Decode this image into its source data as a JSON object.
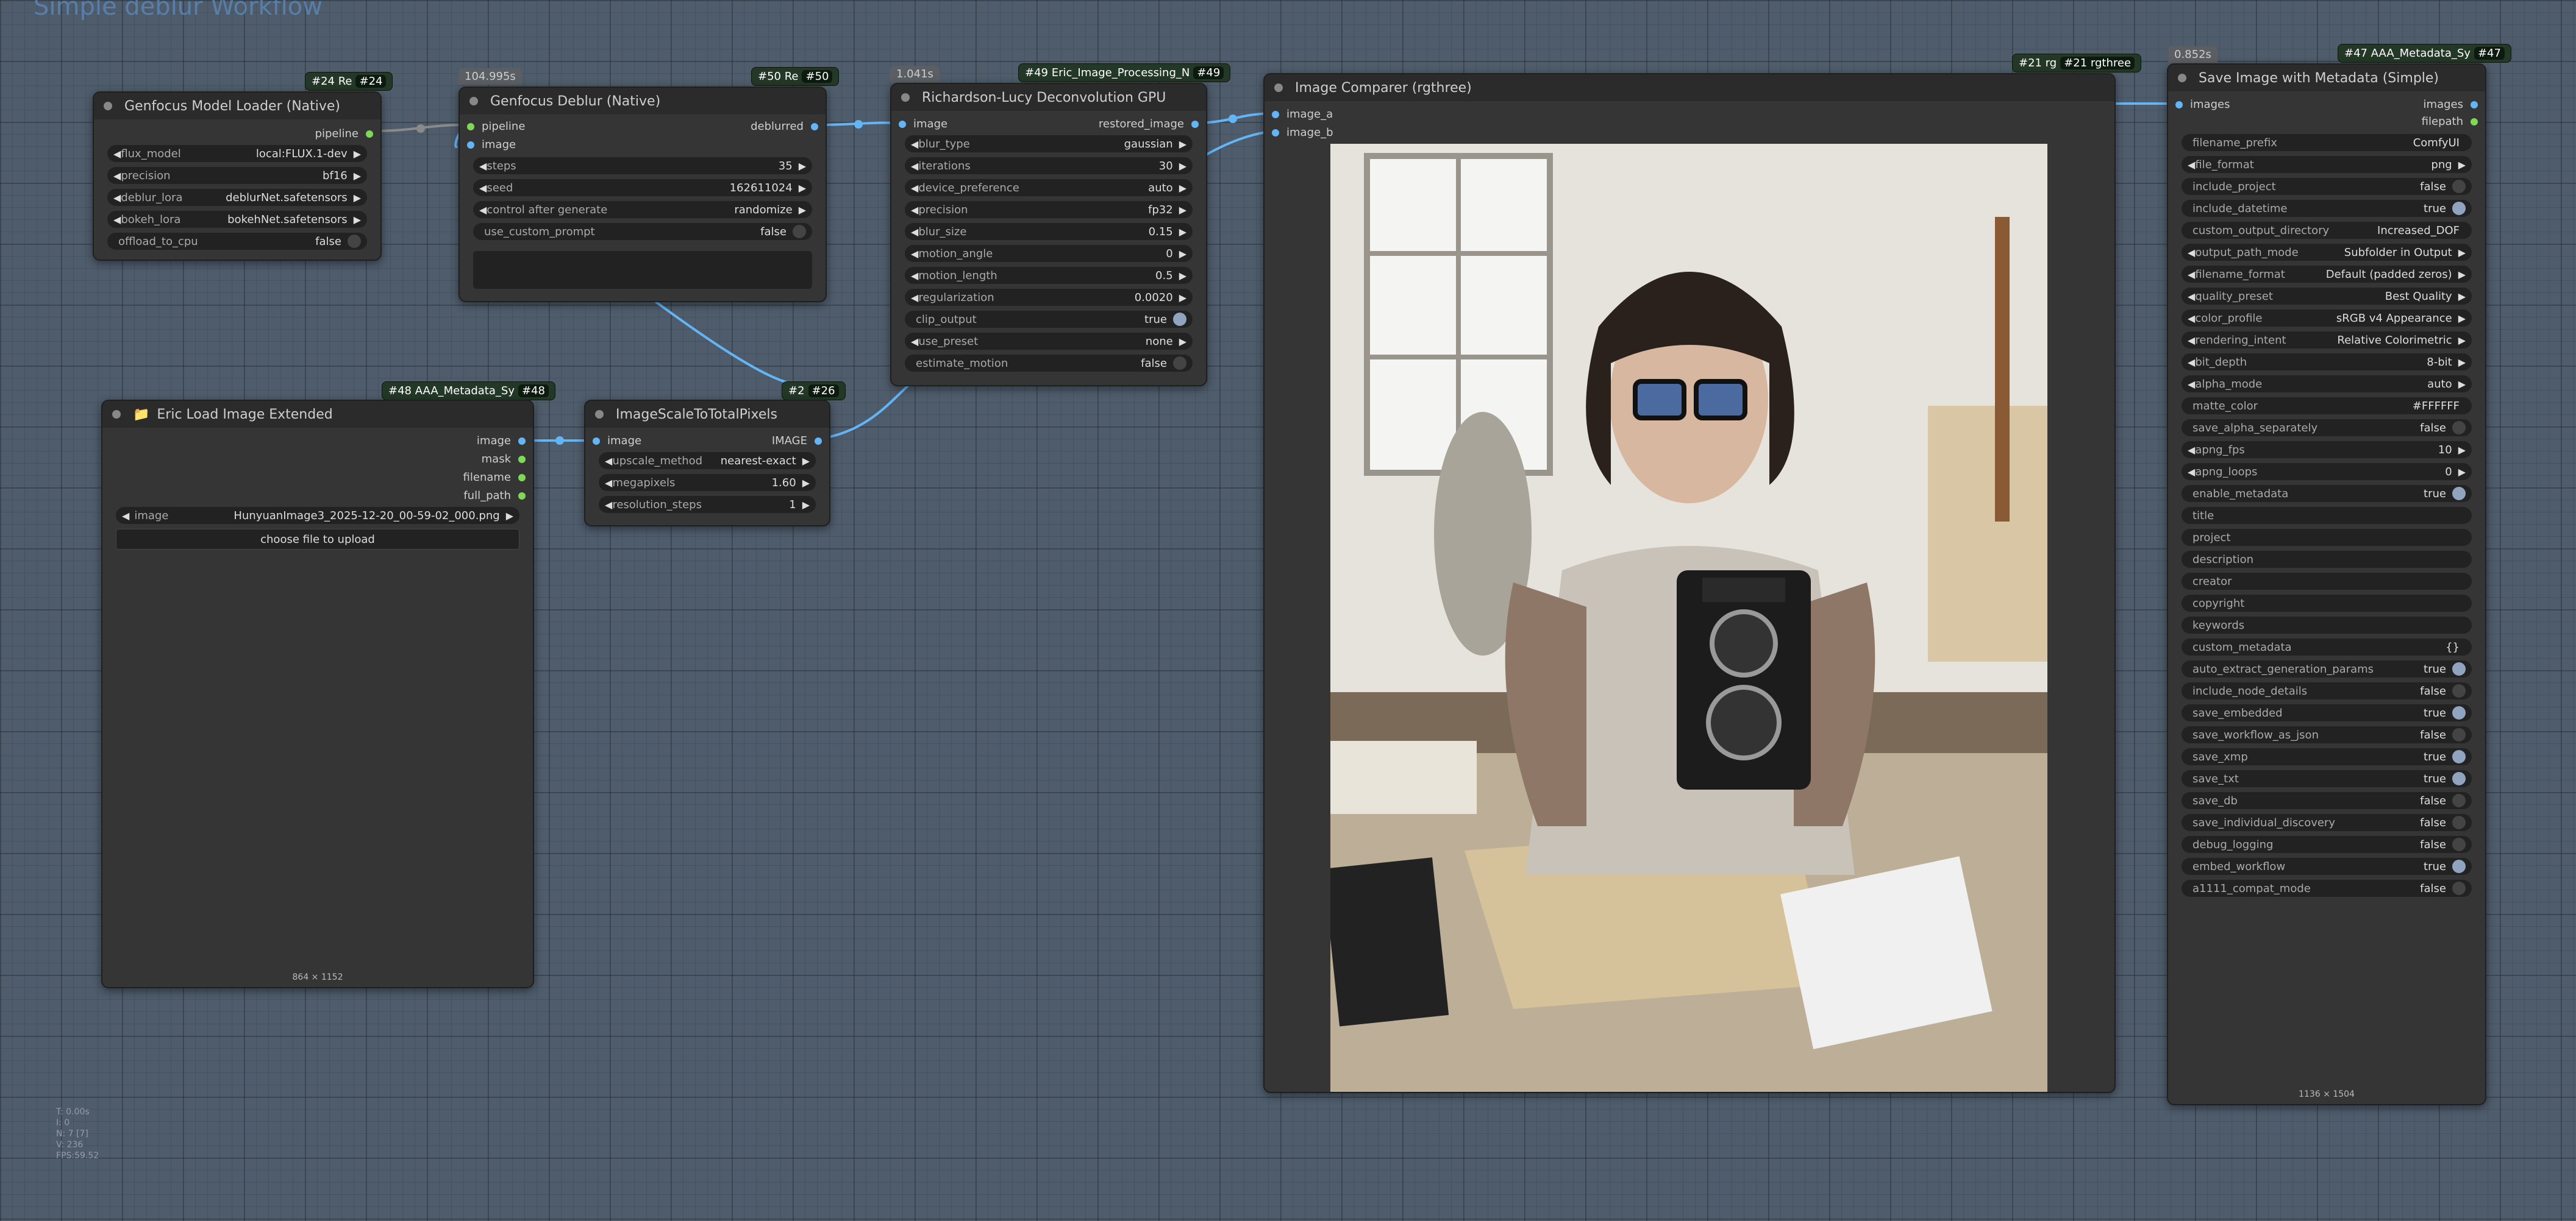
{
  "workflow_title": "Simple deblur Workflow",
  "colors": {
    "link": "#64b5f6",
    "badge": "#233827",
    "node_bg": "#353535"
  },
  "nodes": {
    "model_loader": {
      "title": "Genfocus Model Loader (Native)",
      "tag": "#24 Re",
      "tag_num": "#24",
      "outputs": [
        "pipeline"
      ],
      "widgets": [
        {
          "label": "flux_model",
          "value": "local:FLUX.1-dev"
        },
        {
          "label": "precision",
          "value": "bf16"
        },
        {
          "label": "deblur_lora",
          "value": "deblurNet.safetensors"
        },
        {
          "label": "bokeh_lora",
          "value": "bokehNet.safetensors"
        },
        {
          "label": "offload_to_cpu",
          "value": "false"
        }
      ]
    },
    "deblur": {
      "title": "Genfocus Deblur (Native)",
      "time": "104.995s",
      "tag": "#50 Re",
      "tag_num": "#50",
      "inputs": [
        "pipeline",
        "image"
      ],
      "outputs": [
        "deblurred"
      ],
      "widgets": [
        {
          "label": "steps",
          "value": "35"
        },
        {
          "label": "seed",
          "value": "162611024"
        },
        {
          "label": "control after generate",
          "value": "randomize"
        },
        {
          "label": "use_custom_prompt",
          "value": "false"
        }
      ]
    },
    "rl": {
      "title": "Richardson-Lucy Deconvolution GPU",
      "time": "1.041s",
      "tag": "#49 Eric_Image_Processing_N",
      "tag_num": "#49",
      "inputs": [
        "image"
      ],
      "outputs": [
        "restored_image"
      ],
      "widgets": [
        {
          "label": "blur_type",
          "value": "gaussian"
        },
        {
          "label": "iterations",
          "value": "30"
        },
        {
          "label": "device_preference",
          "value": "auto"
        },
        {
          "label": "precision",
          "value": "fp32"
        },
        {
          "label": "blur_size",
          "value": "0.15"
        },
        {
          "label": "motion_angle",
          "value": "0"
        },
        {
          "label": "motion_length",
          "value": "0.5"
        },
        {
          "label": "regularization",
          "value": "0.0020"
        },
        {
          "label": "clip_output",
          "value": "true"
        },
        {
          "label": "use_preset",
          "value": "none"
        },
        {
          "label": "estimate_motion",
          "value": "false"
        }
      ]
    },
    "comparer": {
      "title": "Image Comparer (rgthree)",
      "tag": "#21 rg",
      "tag_extra": "#21 rgthree",
      "inputs": [
        "image_a",
        "image_b"
      ]
    },
    "save": {
      "title": "Save Image with Metadata (Simple)",
      "time": "0.852s",
      "tag": "#47 AAA_Metadata_Sy",
      "tag_num": "#47",
      "inputs": [
        "images"
      ],
      "outputs": [
        "images",
        "filepath"
      ],
      "size_label": "1136 × 1504",
      "widgets": [
        {
          "label": "filename_prefix",
          "value": "ComfyUI"
        },
        {
          "label": "file_format",
          "value": "png"
        },
        {
          "label": "include_project",
          "value": "false"
        },
        {
          "label": "include_datetime",
          "value": "true"
        },
        {
          "label": "custom_output_directory",
          "value": "Increased_DOF"
        },
        {
          "label": "output_path_mode",
          "value": "Subfolder in Output"
        },
        {
          "label": "filename_format",
          "value": "Default (padded zeros)"
        },
        {
          "label": "quality_preset",
          "value": "Best Quality"
        },
        {
          "label": "color_profile",
          "value": "sRGB v4 Appearance"
        },
        {
          "label": "rendering_intent",
          "value": "Relative Colorimetric"
        },
        {
          "label": "bit_depth",
          "value": "8-bit"
        },
        {
          "label": "alpha_mode",
          "value": "auto"
        },
        {
          "label": "matte_color",
          "value": "#FFFFFF"
        },
        {
          "label": "save_alpha_separately",
          "value": "false"
        },
        {
          "label": "apng_fps",
          "value": "10"
        },
        {
          "label": "apng_loops",
          "value": "0"
        },
        {
          "label": "enable_metadata",
          "value": "true"
        },
        {
          "label": "title",
          "value": ""
        },
        {
          "label": "project",
          "value": ""
        },
        {
          "label": "description",
          "value": ""
        },
        {
          "label": "creator",
          "value": ""
        },
        {
          "label": "copyright",
          "value": ""
        },
        {
          "label": "keywords",
          "value": ""
        },
        {
          "label": "custom_metadata",
          "value": "{}"
        },
        {
          "label": "auto_extract_generation_params",
          "value": "true"
        },
        {
          "label": "include_node_details",
          "value": "false"
        },
        {
          "label": "save_embedded",
          "value": "true"
        },
        {
          "label": "save_workflow_as_json",
          "value": "false"
        },
        {
          "label": "save_xmp",
          "value": "true"
        },
        {
          "label": "save_txt",
          "value": "true"
        },
        {
          "label": "save_db",
          "value": "false"
        },
        {
          "label": "save_individual_discovery",
          "value": "false"
        },
        {
          "label": "debug_logging",
          "value": "false"
        },
        {
          "label": "embed_workflow",
          "value": "true"
        },
        {
          "label": "a1111_compat_mode",
          "value": "false"
        }
      ]
    },
    "load": {
      "title": "Eric Load Image Extended",
      "tag": "#48 AAA_Metadata_Sy",
      "tag_num": "#48",
      "outputs": [
        "image",
        "mask",
        "filename",
        "full_path"
      ],
      "image_value": "HunyuanImage3_2025-12-20_00-59-02_000.png",
      "image_label": "image",
      "upload_label": "choose file to upload",
      "size_label": "864 × 1152"
    },
    "scale": {
      "title": "ImageScaleToTotalPixels",
      "tag": "#2",
      "tag_num": "#26",
      "inputs": [
        "image"
      ],
      "outputs": [
        "IMAGE"
      ],
      "widgets": [
        {
          "label": "upscale_method",
          "value": "nearest-exact"
        },
        {
          "label": "megapixels",
          "value": "1.60"
        },
        {
          "label": "resolution_steps",
          "value": "1"
        }
      ]
    }
  },
  "stats": [
    "T: 0.00s",
    "I: 0",
    "N: 7 [7]",
    "V: 236",
    "FPS:59.52"
  ]
}
